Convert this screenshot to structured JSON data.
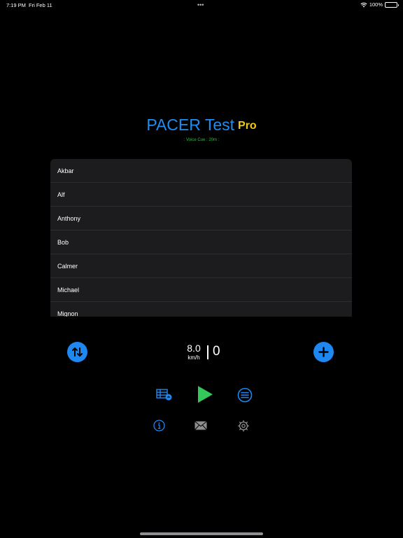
{
  "status_bar": {
    "time": "7:19 PM",
    "date": "Fri Feb 11",
    "dots": "•••",
    "battery": "100%"
  },
  "header": {
    "title": "PACER Test",
    "badge": "Pro",
    "voice_cue": ": Voice Cue : 20m :"
  },
  "runners": [
    {
      "name": "Akbar"
    },
    {
      "name": "Alf"
    },
    {
      "name": "Anthony"
    },
    {
      "name": "Bob"
    },
    {
      "name": "Calmer"
    },
    {
      "name": "Michael"
    },
    {
      "name": "Mignon"
    }
  ],
  "controls": {
    "speed": "8.0",
    "speed_unit": "km/h",
    "level": "0"
  },
  "icons": {
    "sort": "sort-arrows-icon",
    "add": "plus-icon",
    "table": "table-timer-icon",
    "play": "play-icon",
    "list": "list-icon",
    "info": "info-icon",
    "mail": "mail-icon",
    "settings": "gear-icon"
  },
  "colors": {
    "accent": "#1e88f0",
    "title": "#1e8cf0",
    "pro": "#f0c818",
    "voice_cue": "#2fbf3f",
    "play": "#34c759",
    "list_bg": "#1c1c1e"
  }
}
